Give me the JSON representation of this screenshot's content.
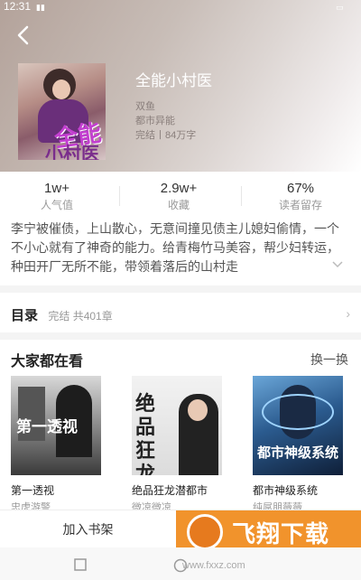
{
  "status_bar": {
    "time": "12:31",
    "signal_icon": "signal-icon",
    "battery_icon": "battery-icon"
  },
  "book": {
    "title": "全能小村医",
    "cover_title_line1": "全能",
    "cover_title_line2": "小村医",
    "author": "双鱼",
    "category": "都市异能",
    "status": "完结丨84万字"
  },
  "stats": [
    {
      "value": "1w+",
      "label": "人气值"
    },
    {
      "value": "2.9w+",
      "label": "收藏"
    },
    {
      "value": "67%",
      "label": "读者留存"
    }
  ],
  "description": "李宁被催债，上山散心，无意间撞见债主儿媳妇偷情，一个不小心就有了神奇的能力。给青梅竹马美容，帮少妇转运，种田开厂无所不能，带领着落后的山村走",
  "toc": {
    "label": "目录",
    "info": "完结 共401章"
  },
  "recommend": {
    "title": "大家都在看",
    "refresh_label": "换一换",
    "books": [
      {
        "name": "第一透视",
        "author": "忠虎游警",
        "cover_text": "第一透视"
      },
      {
        "name": "绝品狂龙潜都市",
        "author": "微凉微凉",
        "cover_text": "绝品狂龙"
      },
      {
        "name": "都市神级系统",
        "author": "纯屌朋薇薇",
        "cover_text": "都市神级系统"
      }
    ]
  },
  "bottom_bar": {
    "add_shelf_label": "加入书架",
    "watermark_text": "飞翔下载",
    "watermark_url": "www.fxxz.com"
  },
  "colors": {
    "accent": "#f1932c",
    "header_gradient_start": "#b3a29a"
  }
}
